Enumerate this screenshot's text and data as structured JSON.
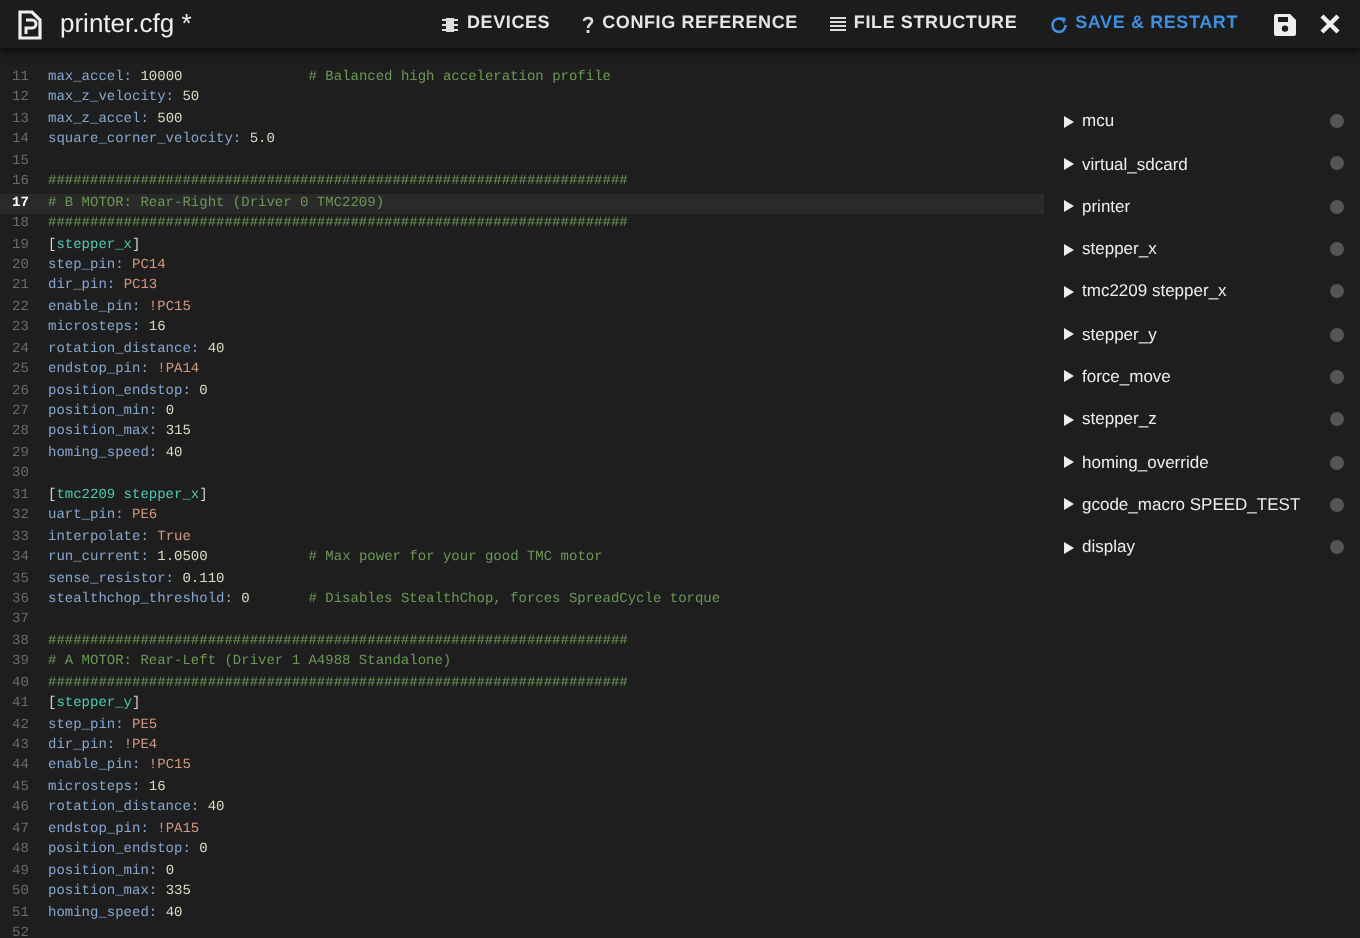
{
  "header": {
    "title": "printer.cfg *",
    "buttons": [
      {
        "kind": "devices",
        "label": "DEVICES"
      },
      {
        "kind": "reference",
        "label": "CONFIG REFERENCE"
      },
      {
        "kind": "structure",
        "label": "FILE STRUCTURE"
      },
      {
        "kind": "save_restart",
        "label": "SAVE & RESTART"
      }
    ]
  },
  "editor": {
    "lines": [
      {
        "n": "11",
        "current": false,
        "code": [
          {
            "kind": "key",
            "text": "max_accel:"
          },
          {
            "kind": "num",
            "text": "10000"
          }
        ],
        "comment": "# Balanced high acceleration profile"
      },
      {
        "n": "12",
        "current": false,
        "code": [
          {
            "kind": "key",
            "text": "max_z_velocity:"
          },
          {
            "kind": "num",
            "text": "50"
          }
        ]
      },
      {
        "n": "13",
        "current": false,
        "code": [
          {
            "kind": "key",
            "text": "max_z_accel:"
          },
          {
            "kind": "num",
            "text": "500"
          }
        ]
      },
      {
        "n": "14",
        "current": false,
        "code": [
          {
            "kind": "key",
            "text": "square_corner_velocity:"
          },
          {
            "kind": "num",
            "text": "5.0"
          }
        ]
      },
      {
        "n": "15",
        "current": false
      },
      {
        "n": "16",
        "current": false,
        "comment": "#####################################################################"
      },
      {
        "n": "17",
        "current": true,
        "comment": "# B MOTOR: Rear-Right (Driver 0 TMC2209)"
      },
      {
        "n": "18",
        "current": false,
        "comment": "#####################################################################"
      },
      {
        "n": "19",
        "current": false,
        "code": [
          {
            "kind": "punct",
            "text": "["
          },
          {
            "kind": "section",
            "text": "stepper_x"
          },
          {
            "kind": "punct",
            "text": "]"
          }
        ]
      },
      {
        "n": "20",
        "current": false,
        "code": [
          {
            "kind": "key",
            "text": "step_pin:"
          },
          {
            "kind": "str",
            "text": "PC14"
          }
        ]
      },
      {
        "n": "21",
        "current": false,
        "code": [
          {
            "kind": "key",
            "text": "dir_pin:"
          },
          {
            "kind": "str",
            "text": "PC13"
          }
        ]
      },
      {
        "n": "22",
        "current": false,
        "code": [
          {
            "kind": "key",
            "text": "enable_pin:"
          },
          {
            "kind": "str",
            "text": "!PC15"
          }
        ]
      },
      {
        "n": "23",
        "current": false,
        "code": [
          {
            "kind": "key",
            "text": "microsteps:"
          },
          {
            "kind": "num",
            "text": "16"
          }
        ]
      },
      {
        "n": "24",
        "current": false,
        "code": [
          {
            "kind": "key",
            "text": "rotation_distance:"
          },
          {
            "kind": "num",
            "text": "40"
          }
        ]
      },
      {
        "n": "25",
        "current": false,
        "code": [
          {
            "kind": "key",
            "text": "endstop_pin:"
          },
          {
            "kind": "str",
            "text": "!PA14"
          }
        ]
      },
      {
        "n": "26",
        "current": false,
        "code": [
          {
            "kind": "key",
            "text": "position_endstop:"
          },
          {
            "kind": "num",
            "text": "0"
          }
        ]
      },
      {
        "n": "27",
        "current": false,
        "code": [
          {
            "kind": "key",
            "text": "position_min:"
          },
          {
            "kind": "num",
            "text": "0"
          }
        ]
      },
      {
        "n": "28",
        "current": false,
        "code": [
          {
            "kind": "key",
            "text": "position_max:"
          },
          {
            "kind": "num",
            "text": "315"
          }
        ]
      },
      {
        "n": "29",
        "current": false,
        "code": [
          {
            "kind": "key",
            "text": "homing_speed:"
          },
          {
            "kind": "num",
            "text": "40"
          }
        ]
      },
      {
        "n": "30",
        "current": false
      },
      {
        "n": "31",
        "current": false,
        "code": [
          {
            "kind": "punct",
            "text": "["
          },
          {
            "kind": "section",
            "text": "tmc2209 stepper_x"
          },
          {
            "kind": "punct",
            "text": "]"
          }
        ]
      },
      {
        "n": "32",
        "current": false,
        "code": [
          {
            "kind": "key",
            "text": "uart_pin:"
          },
          {
            "kind": "str",
            "text": "PE6"
          }
        ]
      },
      {
        "n": "33",
        "current": false,
        "code": [
          {
            "kind": "key",
            "text": "interpolate:"
          },
          {
            "kind": "str",
            "text": "True"
          }
        ]
      },
      {
        "n": "34",
        "current": false,
        "code": [
          {
            "kind": "key",
            "text": "run_current:"
          },
          {
            "kind": "num",
            "text": "1.0500"
          }
        ],
        "comment": "# Max power for your good TMC motor"
      },
      {
        "n": "35",
        "current": false,
        "code": [
          {
            "kind": "key",
            "text": "sense_resistor:"
          },
          {
            "kind": "num",
            "text": "0.110"
          }
        ]
      },
      {
        "n": "36",
        "current": false,
        "code": [
          {
            "kind": "key",
            "text": "stealthchop_threshold:"
          },
          {
            "kind": "num",
            "text": "0"
          }
        ],
        "comment": "# Disables StealthChop, forces SpreadCycle torque"
      },
      {
        "n": "37",
        "current": false
      },
      {
        "n": "38",
        "current": false,
        "comment": "#####################################################################"
      },
      {
        "n": "39",
        "current": false,
        "comment": "# A MOTOR: Rear-Left (Driver 1 A4988 Standalone)"
      },
      {
        "n": "40",
        "current": false,
        "comment": "#####################################################################"
      },
      {
        "n": "41",
        "current": false,
        "code": [
          {
            "kind": "punct",
            "text": "["
          },
          {
            "kind": "section",
            "text": "stepper_y"
          },
          {
            "kind": "punct",
            "text": "]"
          }
        ]
      },
      {
        "n": "42",
        "current": false,
        "code": [
          {
            "kind": "key",
            "text": "step_pin:"
          },
          {
            "kind": "str",
            "text": "PE5"
          }
        ]
      },
      {
        "n": "43",
        "current": false,
        "code": [
          {
            "kind": "key",
            "text": "dir_pin:"
          },
          {
            "kind": "str",
            "text": "!PE4"
          }
        ]
      },
      {
        "n": "44",
        "current": false,
        "code": [
          {
            "kind": "key",
            "text": "enable_pin:"
          },
          {
            "kind": "str",
            "text": "!PC15"
          }
        ]
      },
      {
        "n": "45",
        "current": false,
        "code": [
          {
            "kind": "key",
            "text": "microsteps:"
          },
          {
            "kind": "num",
            "text": "16"
          }
        ]
      },
      {
        "n": "46",
        "current": false,
        "code": [
          {
            "kind": "key",
            "text": "rotation_distance:"
          },
          {
            "kind": "num",
            "text": "40"
          }
        ]
      },
      {
        "n": "47",
        "current": false,
        "code": [
          {
            "kind": "key",
            "text": "endstop_pin:"
          },
          {
            "kind": "str",
            "text": "!PA15"
          }
        ]
      },
      {
        "n": "48",
        "current": false,
        "code": [
          {
            "kind": "key",
            "text": "position_endstop:"
          },
          {
            "kind": "num",
            "text": "0"
          }
        ]
      },
      {
        "n": "49",
        "current": false,
        "code": [
          {
            "kind": "key",
            "text": "position_min:"
          },
          {
            "kind": "num",
            "text": "0"
          }
        ]
      },
      {
        "n": "50",
        "current": false,
        "code": [
          {
            "kind": "key",
            "text": "position_max:"
          },
          {
            "kind": "num",
            "text": "335"
          }
        ]
      },
      {
        "n": "51",
        "current": false,
        "code": [
          {
            "kind": "key",
            "text": "homing_speed:"
          },
          {
            "kind": "num",
            "text": "40"
          }
        ]
      },
      {
        "n": "52",
        "current": false
      }
    ]
  },
  "structure": [
    {
      "label": "mcu",
      "expanded": false
    },
    {
      "label": "virtual_sdcard",
      "expanded": false
    },
    {
      "label": "printer",
      "expanded": false
    },
    {
      "label": "stepper_x",
      "expanded": false
    },
    {
      "label": "tmc2209 stepper_x",
      "expanded": false
    },
    {
      "label": "stepper_y",
      "expanded": false
    },
    {
      "label": "force_move",
      "expanded": false
    },
    {
      "label": "stepper_z",
      "expanded": false
    },
    {
      "label": "homing_override",
      "expanded": false
    },
    {
      "label": "gcode_macro SPEED_TEST",
      "expanded": false
    },
    {
      "label": "display",
      "expanded": false
    }
  ]
}
